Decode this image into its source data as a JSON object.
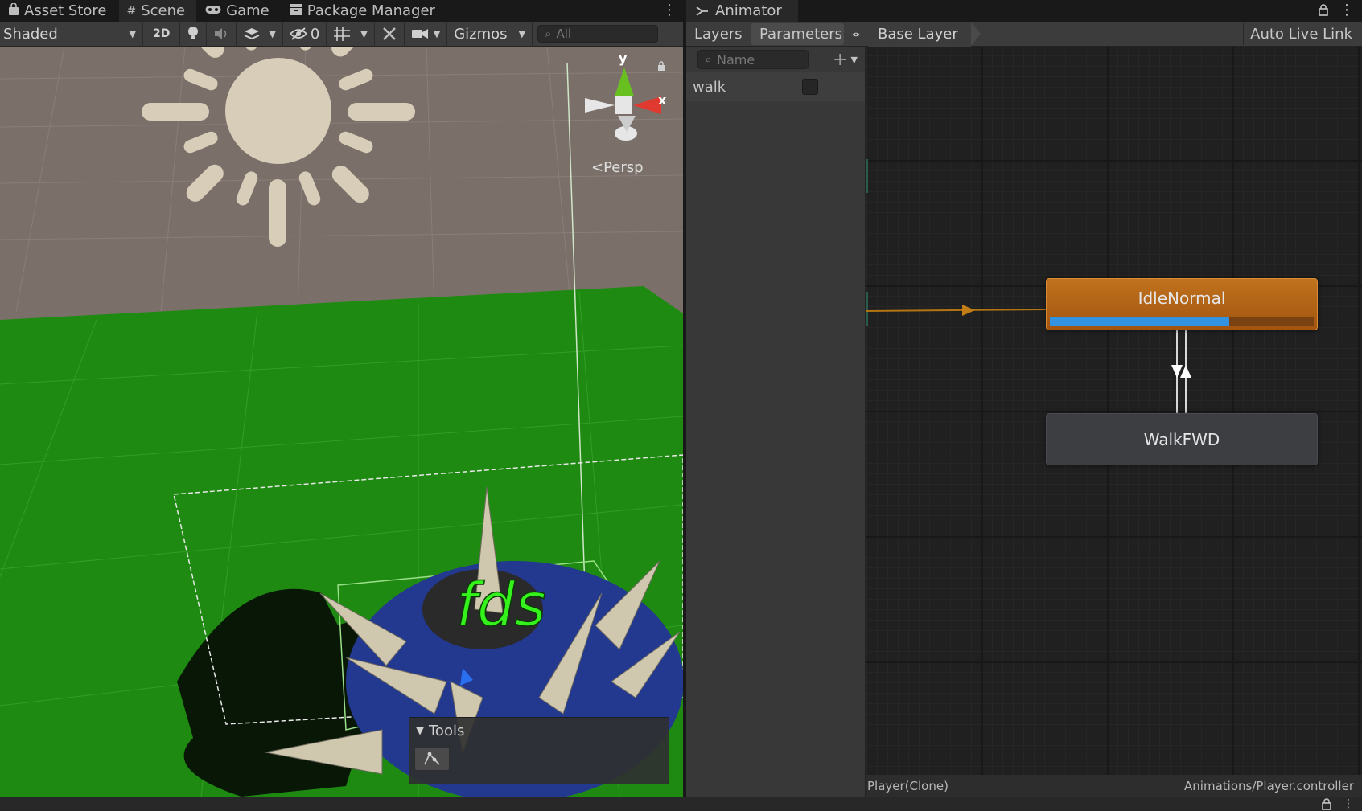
{
  "scene_window": {
    "tabs": [
      {
        "label": "Asset Store",
        "icon": "bag-icon"
      },
      {
        "label": "Scene",
        "icon": "hash-icon"
      },
      {
        "label": "Game",
        "icon": "gamepad-icon"
      },
      {
        "label": "Package Manager",
        "icon": "package-icon"
      }
    ],
    "toolbar": {
      "shading_mode": "Shaded",
      "mode_2d": "2D",
      "hidden_count": "0",
      "gizmos": "Gizmos",
      "search_placeholder": "All"
    },
    "viewport": {
      "projection": "Persp",
      "axis_y": "y",
      "axis_x": "x",
      "text_object": "fds"
    },
    "tools_panel": {
      "title": "Tools"
    }
  },
  "animator": {
    "tab_label": "Animator",
    "tabs": {
      "layers": "Layers",
      "parameters": "Parameters"
    },
    "breadcrumb": "Base Layer",
    "auto_live_link": "Auto Live Link",
    "param_search_placeholder": "Name",
    "parameters": [
      {
        "name": "walk",
        "type": "bool",
        "checked": false
      }
    ],
    "states": [
      {
        "name": "IdleNormal",
        "default": true,
        "progress": 0.68
      },
      {
        "name": "WalkFWD",
        "default": false
      }
    ],
    "status": {
      "left": "Player(Clone)",
      "right": "Animations/Player.controller"
    }
  },
  "colors": {
    "default_state": "#b8661a",
    "progress": "#3294e0",
    "grass": "#1f8a12",
    "text_green": "#36f21c"
  }
}
